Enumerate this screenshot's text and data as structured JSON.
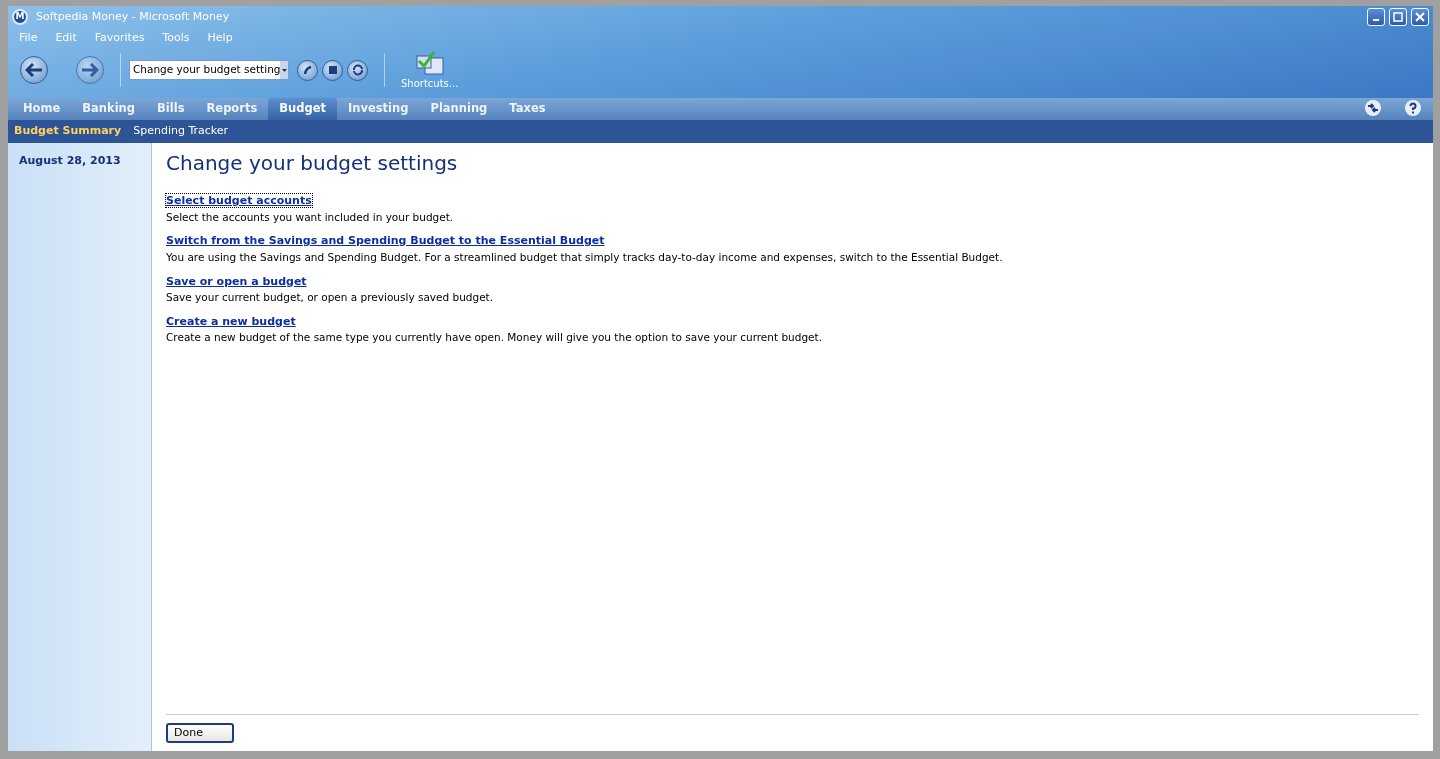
{
  "window": {
    "logo_letter": "M",
    "title": "Softpedia Money - Microsoft Money"
  },
  "menu": [
    "File",
    "Edit",
    "Favorites",
    "Tools",
    "Help"
  ],
  "toolbar": {
    "address": "Change your budget setting",
    "shortcuts_label": "Shortcuts..."
  },
  "tabs": [
    {
      "label": "Home",
      "selected": false
    },
    {
      "label": "Banking",
      "selected": false
    },
    {
      "label": "Bills",
      "selected": false
    },
    {
      "label": "Reports",
      "selected": false
    },
    {
      "label": "Budget",
      "selected": true
    },
    {
      "label": "Investing",
      "selected": false
    },
    {
      "label": "Planning",
      "selected": false
    },
    {
      "label": "Taxes",
      "selected": false
    }
  ],
  "subtabs": [
    {
      "label": "Budget Summary",
      "selected": true
    },
    {
      "label": "Spending Tracker",
      "selected": false
    }
  ],
  "sidebar": {
    "date": "August 28, 2013"
  },
  "content": {
    "heading": "Change your budget settings",
    "options": [
      {
        "link": "Select budget accounts",
        "description": "Select the accounts you want included in your budget.",
        "focused": true
      },
      {
        "link": "Switch from the Savings and Spending Budget to the Essential Budget",
        "description": "You are using the Savings and Spending Budget. For a streamlined budget that simply tracks day-to-day income and expenses, switch to the Essential Budget.",
        "focused": false
      },
      {
        "link": "Save or open a budget",
        "description": "Save your current budget, or open a previously saved budget.",
        "focused": false
      },
      {
        "link": "Create a new budget",
        "description": "Create a new budget of the same type you currently have open. Money will give you the option to save your current budget.",
        "focused": false
      }
    ],
    "done_button": "Done"
  }
}
